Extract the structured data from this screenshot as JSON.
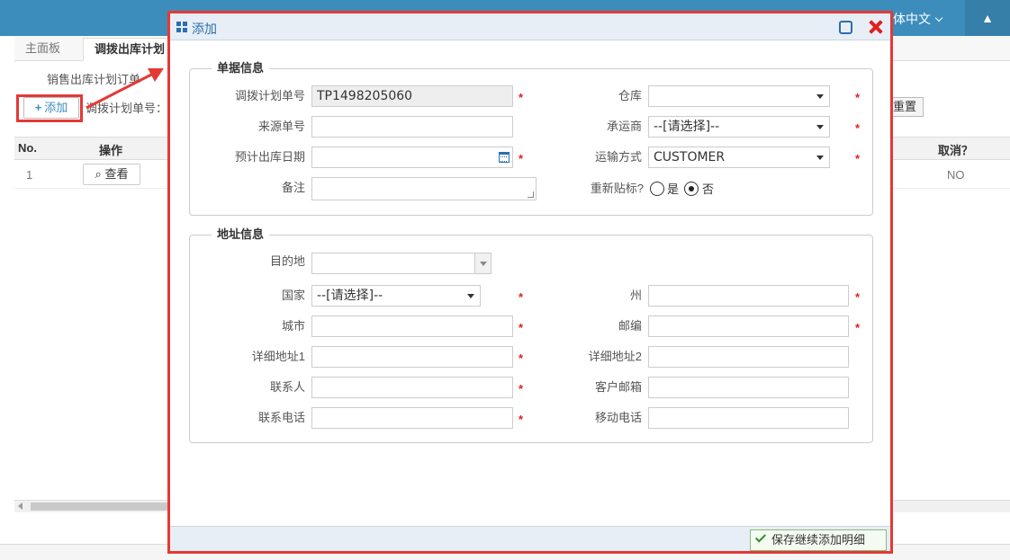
{
  "topbar": {
    "language": "体中文",
    "tree_icon": "tree-icon"
  },
  "background": {
    "tabs": [
      {
        "label": "主面板"
      },
      {
        "label": "调拨出库计划"
      }
    ],
    "panel_legend": "销售出库计划订单",
    "add_button": "添加",
    "filter_label": "调拨计划单号：",
    "reset_button": "重置",
    "grid": {
      "columns": {
        "no": "No.",
        "op": "操作",
        "cancel": "取消？"
      },
      "rows": [
        {
          "no": "1",
          "view": "查看",
          "cancel": "NO"
        }
      ]
    }
  },
  "dialog": {
    "title": "添加",
    "sections": {
      "doc": "单据信息",
      "address": "地址信息"
    },
    "fields": {
      "plan_no": {
        "label": "调拨计划单号",
        "value": "TP1498205060"
      },
      "source_no": {
        "label": "来源单号",
        "value": ""
      },
      "ship_date": {
        "label": "预计出库日期",
        "value": ""
      },
      "remark": {
        "label": "备注",
        "value": ""
      },
      "warehouse": {
        "label": "仓库",
        "value": ""
      },
      "carrier": {
        "label": "承运商",
        "value": "--[请选择]--"
      },
      "transport": {
        "label": "运输方式",
        "value": "CUSTOMER"
      },
      "relabel": {
        "label": "重新贴标?",
        "yes": "是",
        "no": "否",
        "selected": "no"
      },
      "destination": {
        "label": "目的地",
        "value": ""
      },
      "country": {
        "label": "国家",
        "value": "--[请选择]--"
      },
      "state": {
        "label": "州",
        "value": ""
      },
      "city": {
        "label": "城市",
        "value": ""
      },
      "zip": {
        "label": "邮编",
        "value": ""
      },
      "addr1": {
        "label": "详细地址1",
        "value": ""
      },
      "addr2": {
        "label": "详细地址2",
        "value": ""
      },
      "contact": {
        "label": "联系人",
        "value": ""
      },
      "email": {
        "label": "客户邮箱",
        "value": ""
      },
      "phone": {
        "label": "联系电话",
        "value": ""
      },
      "mobile": {
        "label": "移动电话",
        "value": ""
      }
    },
    "required_mark": "*",
    "save_button": "保存继续添加明细"
  },
  "colors": {
    "highlight": "#e53935",
    "primary": "#3c8dbc",
    "required": "#e02020"
  }
}
